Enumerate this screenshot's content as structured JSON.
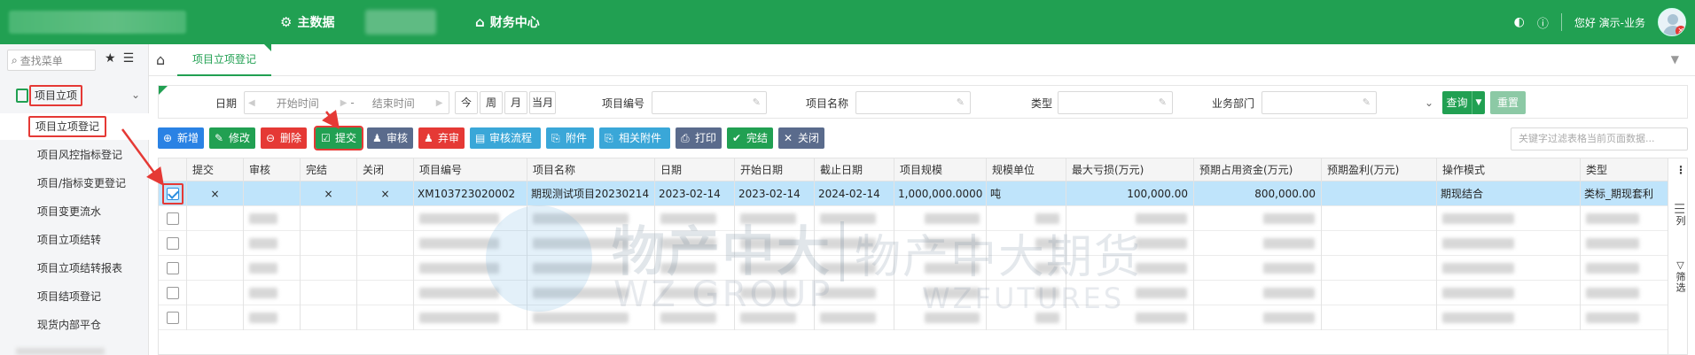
{
  "topbar": {
    "nav": [
      {
        "icon": "gear-icon",
        "label": "主数据"
      },
      {
        "icon": "home-icon",
        "label": "财务中心"
      }
    ],
    "greeting": "您好 演示-业务"
  },
  "sidebar": {
    "search_placeholder": "查找菜单",
    "group_label": "项目立项",
    "items": [
      {
        "label": "项目立项登记",
        "active": true
      },
      {
        "label": "项目风控指标登记"
      },
      {
        "label": "项目/指标变更登记"
      },
      {
        "label": "项目变更流水"
      },
      {
        "label": "项目立项结转"
      },
      {
        "label": "项目立项结转报表"
      },
      {
        "label": "项目结项登记"
      },
      {
        "label": "现货内部平仓"
      }
    ]
  },
  "tabs": [
    {
      "label": "项目立项登记"
    }
  ],
  "filter": {
    "date_label": "日期",
    "start_placeholder": "开始时间",
    "end_placeholder": "结束时间",
    "quick": [
      "今",
      "周",
      "月",
      "当月"
    ],
    "fields": [
      "项目编号",
      "项目名称",
      "类型",
      "业务部门"
    ],
    "query_label": "查询",
    "reset_label": "重置"
  },
  "toolbar": {
    "buttons": [
      {
        "label": "新增",
        "icon": "plus-icon",
        "color": "#2a82e4"
      },
      {
        "label": "修改",
        "icon": "edit-icon",
        "color": "#21a052"
      },
      {
        "label": "删除",
        "icon": "minus-icon",
        "color": "#e53935"
      },
      {
        "label": "提交",
        "icon": "check-square-icon",
        "color": "#21a052"
      },
      {
        "label": "审核",
        "icon": "user-icon",
        "color": "#5a6b8c"
      },
      {
        "label": "弃审",
        "icon": "user-x-icon",
        "color": "#e53935"
      },
      {
        "label": "审核流程",
        "icon": "list-icon",
        "color": "#3aa7d8"
      },
      {
        "label": "附件",
        "icon": "paperclip-icon",
        "color": "#3aa7d8"
      },
      {
        "label": "相关附件",
        "icon": "paperclip-icon",
        "color": "#3aa7d8"
      },
      {
        "label": "打印",
        "icon": "print-icon",
        "color": "#5a6b8c"
      },
      {
        "label": "完结",
        "icon": "check-circle-icon",
        "color": "#21a052"
      },
      {
        "label": "关闭",
        "icon": "close-icon",
        "color": "#5a6b8c"
      }
    ],
    "filter_placeholder": "关键字过滤表格当前页面数据..."
  },
  "grid": {
    "columns": [
      "提交",
      "审核",
      "完结",
      "关闭",
      "项目编号",
      "项目名称",
      "日期",
      "开始日期",
      "截止日期",
      "项目规模",
      "规模单位",
      "最大亏损(万元)",
      "预期占用资金(万元)",
      "预期盈利(万元)",
      "操作模式",
      "类型"
    ],
    "rows": [
      {
        "selected": true,
        "cells": [
          "×",
          "",
          "×",
          "×",
          "XM103723020002",
          "期现测试项目20230214",
          "2023-02-14",
          "2023-02-14",
          "2024-02-14",
          "1,000,000.0000",
          "吨",
          "100,000.00",
          "800,000.00",
          "",
          "期现结合",
          "类标_期现套利"
        ]
      }
    ],
    "blurred_row_count": 5
  },
  "right_rail": {
    "columns_label": "列",
    "filter_label": "筛选"
  },
  "watermark": {
    "cn_left": "物产中大",
    "cn_right": "物产中大期货",
    "en_left": "WZ GROUP",
    "en_right": "WZFUTURES"
  }
}
